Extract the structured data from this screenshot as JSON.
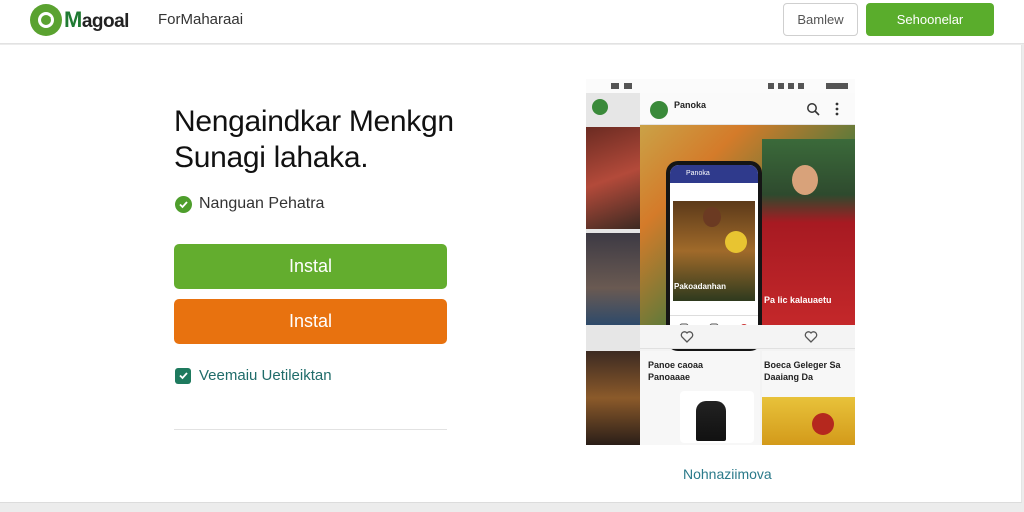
{
  "header": {
    "logo_initial": "M",
    "logo_rest": "agoal",
    "tagline": "ForMaharaai",
    "outline_button": "Bamlew",
    "primary_button": "Sehoonelar"
  },
  "hero": {
    "title_line1": "Nengaindkar Menkgn",
    "title_line2": "Sunagi lahaka."
  },
  "feature": {
    "label": "Nanguan Pehatra"
  },
  "buttons": {
    "install_green": "Instal",
    "install_orange": "Instal"
  },
  "checkbox": {
    "label": "Veemaiu Uetileiktan",
    "checked": true
  },
  "preview": {
    "app_name": "Panoka",
    "phone_header": "Panoka",
    "caption_phone": "Pakoadanhan",
    "caption_right": "Pa lic kalauaetu",
    "caption_bottom_left_1": "Panoe caoaa",
    "caption_bottom_left_2": "Panoaaae",
    "caption_bottom_right_1": "Boeca Geleger Sa",
    "caption_bottom_right_2": "Daaiang Da",
    "link": "Nohnaziimova"
  },
  "colors": {
    "brand_green": "#5aad2c",
    "install_green": "#63ad2e",
    "install_orange": "#e8720f",
    "checkbox_teal": "#1e7a5e"
  },
  "icons": [
    "check-circle-icon",
    "checkbox-checked-icon",
    "search-icon",
    "more-vertical-icon"
  ]
}
